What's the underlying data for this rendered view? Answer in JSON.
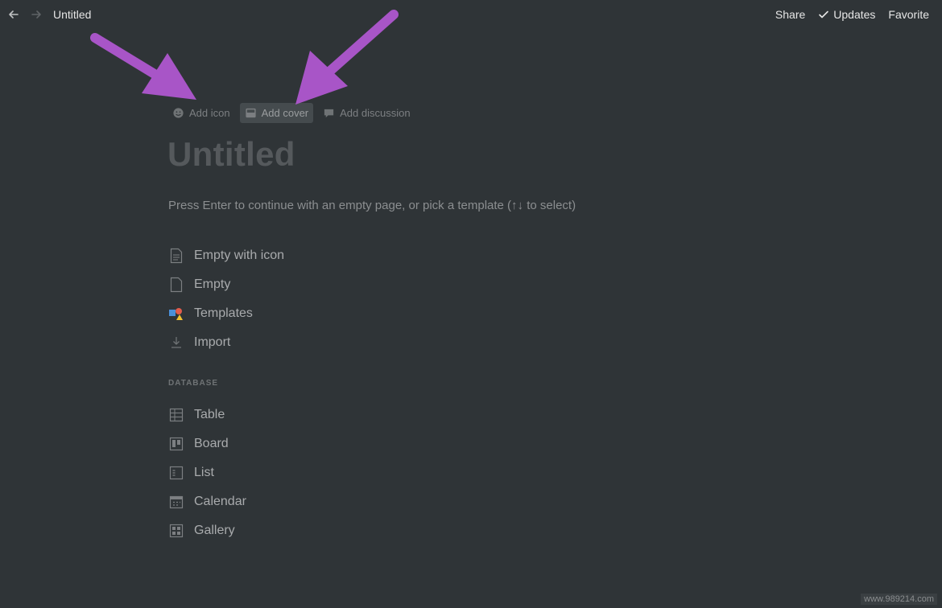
{
  "topbar": {
    "breadcrumb": "Untitled",
    "share_label": "Share",
    "updates_label": "Updates",
    "favorite_label": "Favorite"
  },
  "page_controls": {
    "add_icon_label": "Add icon",
    "add_cover_label": "Add cover",
    "add_discussion_label": "Add discussion"
  },
  "page": {
    "title": "Untitled",
    "hint": "Press Enter to continue with an empty page, or pick a template (↑↓ to select)"
  },
  "templates": [
    {
      "label": "Empty with icon",
      "icon": "page-with-lines-icon"
    },
    {
      "label": "Empty",
      "icon": "blank-page-icon"
    },
    {
      "label": "Templates",
      "icon": "templates-shapes-icon"
    },
    {
      "label": "Import",
      "icon": "download-icon"
    }
  ],
  "database": {
    "section_label": "DATABASE",
    "items": [
      {
        "label": "Table",
        "icon": "table-icon"
      },
      {
        "label": "Board",
        "icon": "board-icon"
      },
      {
        "label": "List",
        "icon": "list-icon"
      },
      {
        "label": "Calendar",
        "icon": "calendar-icon"
      },
      {
        "label": "Gallery",
        "icon": "gallery-icon"
      }
    ]
  },
  "annotation_color": "#a855c7",
  "watermark": "www.989214.com"
}
